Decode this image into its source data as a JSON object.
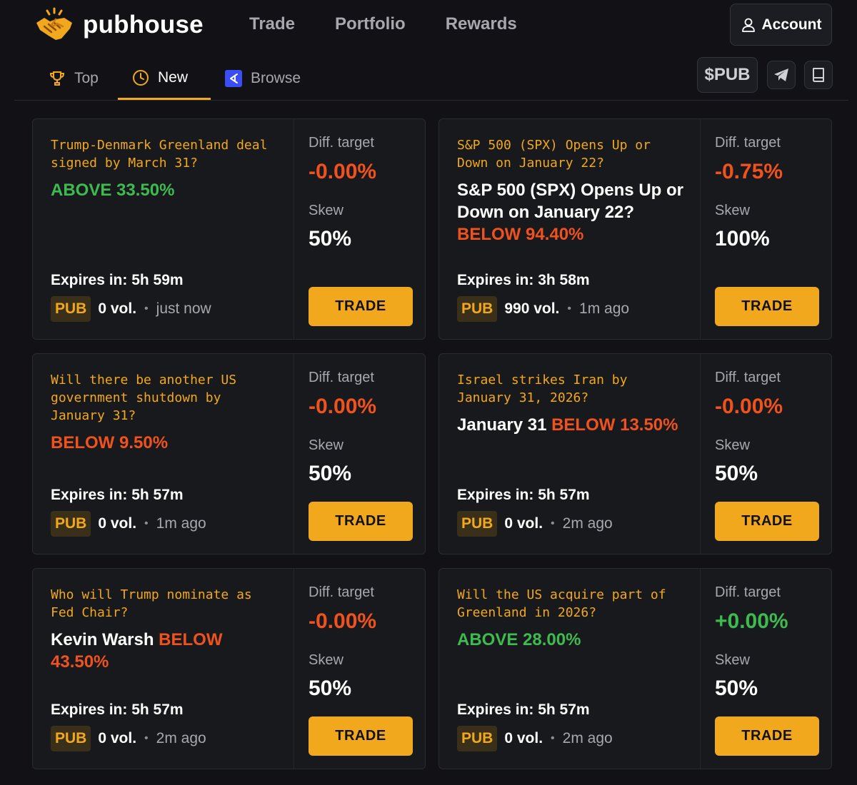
{
  "brand": {
    "name": "pubhouse"
  },
  "nav": {
    "trade": "Trade",
    "portfolio": "Portfolio",
    "rewards": "Rewards",
    "account": "Account"
  },
  "tabs": {
    "top": "Top",
    "new": "New",
    "browse": "Browse"
  },
  "utility": {
    "token": "$PUB"
  },
  "labels": {
    "diff_target": "Diff. target",
    "skew": "Skew",
    "trade": "TRADE",
    "pub": "PUB"
  },
  "colors": {
    "accent": "#f2a81d",
    "green": "#3dbb4f",
    "red": "#f0521e",
    "background": "#121216",
    "card": "#18191d"
  },
  "icons": {
    "logo": "handshake-icon",
    "account": "user-icon",
    "top": "trophy-icon",
    "new": "clock-icon",
    "browse": "browse-icon",
    "telegram": "telegram-icon",
    "docs": "book-icon"
  },
  "cards": [
    {
      "question": "Trump-Denmark Greenland deal signed by March 31?",
      "outcome": "",
      "direction": "ABOVE",
      "price": "33.50%",
      "diff_target": "-0.00%",
      "skew": "50%",
      "expires": "Expires in: 5h 59m",
      "volume": "0 vol.",
      "ago": "just now"
    },
    {
      "question": "S&P 500 (SPX) Opens Up or Down on January 22?",
      "outcome": "S&P 500 (SPX) Opens Up or Down on January 22?",
      "direction": "BELOW",
      "price": "94.40%",
      "diff_target": "-0.75%",
      "skew": "100%",
      "expires": "Expires in: 3h 58m",
      "volume": "990 vol.",
      "ago": "1m ago"
    },
    {
      "question": "Will there be another US government shutdown by January 31?",
      "outcome": "",
      "direction": "BELOW",
      "price": "9.50%",
      "diff_target": "-0.00%",
      "skew": "50%",
      "expires": "Expires in: 5h 57m",
      "volume": "0 vol.",
      "ago": "1m ago"
    },
    {
      "question": "Israel strikes Iran by January 31, 2026?",
      "outcome": "January 31",
      "direction": "BELOW",
      "price": "13.50%",
      "diff_target": "-0.00%",
      "skew": "50%",
      "expires": "Expires in: 5h 57m",
      "volume": "0 vol.",
      "ago": "2m ago"
    },
    {
      "question": "Who will Trump nominate as Fed Chair?",
      "outcome": "Kevin Warsh",
      "direction": "BELOW",
      "price": "43.50%",
      "diff_target": "-0.00%",
      "skew": "50%",
      "expires": "Expires in: 5h 57m",
      "volume": "0 vol.",
      "ago": "2m ago"
    },
    {
      "question": "Will the US acquire part of Greenland in 2026?",
      "outcome": "",
      "direction": "ABOVE",
      "price": "28.00%",
      "diff_target": "+0.00%",
      "skew": "50%",
      "expires": "Expires in: 5h 57m",
      "volume": "0 vol.",
      "ago": "2m ago"
    }
  ]
}
